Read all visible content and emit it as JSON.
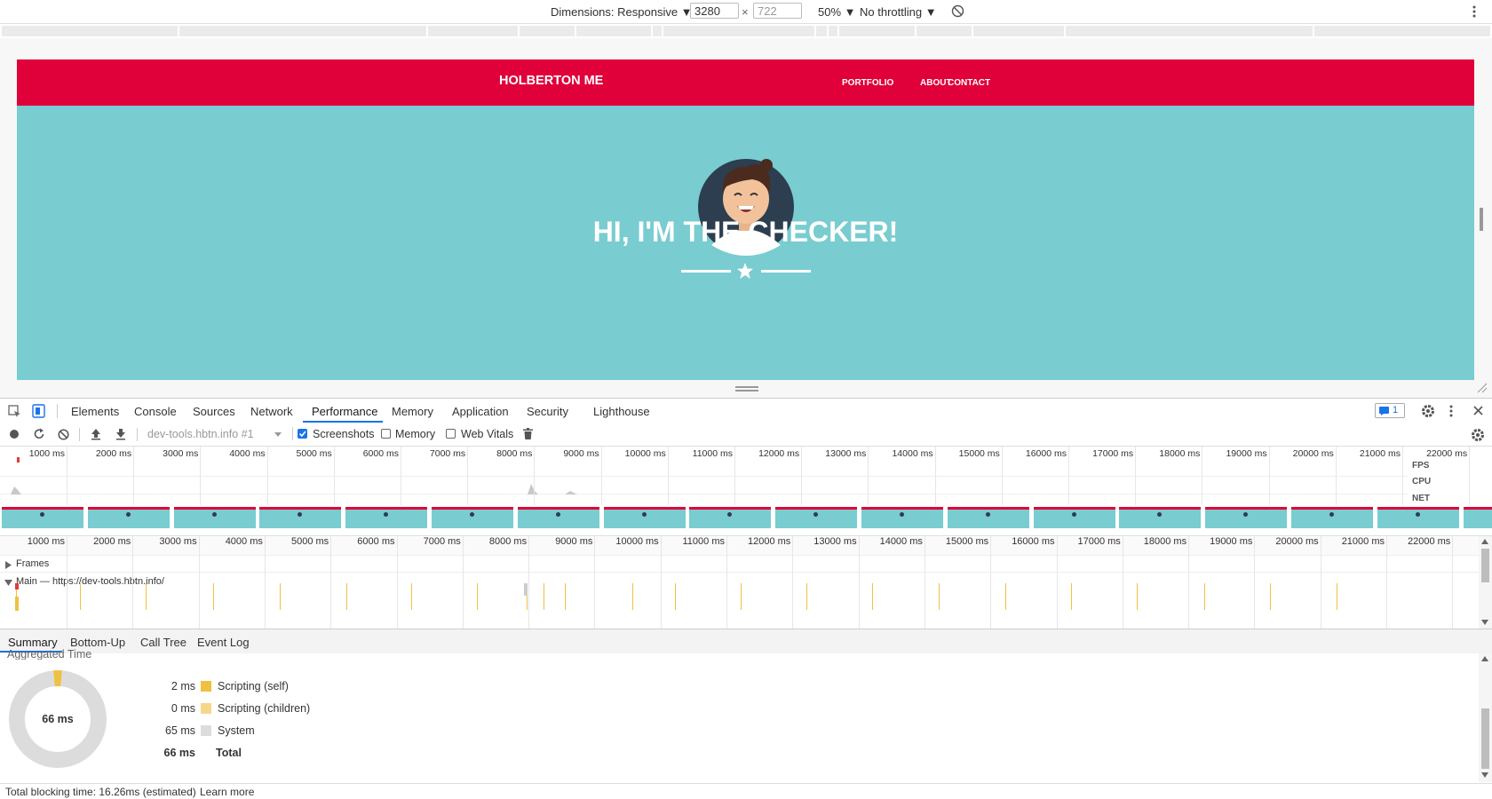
{
  "device_toolbar": {
    "dimensions_label": "Dimensions: Responsive ▼",
    "width": "3280",
    "height_placeholder": "722",
    "times": "×",
    "zoom": "50% ▼",
    "throttling": "No throttling ▼"
  },
  "site": {
    "brand": "HOLBERTON ME",
    "nav": [
      "PORTFOLIO",
      "ABOUT",
      "CONTACT"
    ],
    "heading": "HI, I'M THE CHECKER!"
  },
  "devtools_tabs": [
    "Elements",
    "Console",
    "Sources",
    "Network",
    "Performance",
    "Memory",
    "Application",
    "Security",
    "Lighthouse"
  ],
  "active_tab": "Performance",
  "issues_count": "1",
  "perf_toolbar": {
    "recording_select": "dev-tools.hbtn.info #1",
    "screenshots_label": "Screenshots",
    "memory_label": "Memory",
    "web_vitals_label": "Web Vitals"
  },
  "overview": {
    "ticks": [
      "1000 ms",
      "2000 ms",
      "3000 ms",
      "4000 ms",
      "5000 ms",
      "6000 ms",
      "7000 ms",
      "8000 ms",
      "9000 ms",
      "10000 ms",
      "11000 ms",
      "12000 ms",
      "13000 ms",
      "14000 ms",
      "15000 ms",
      "16000 ms",
      "17000 ms",
      "18000 ms",
      "19000 ms",
      "20000 ms",
      "21000 ms",
      "22000 ms"
    ],
    "labels": [
      "FPS",
      "CPU",
      "NET"
    ]
  },
  "flame": {
    "ticks": [
      "1000 ms",
      "2000 ms",
      "3000 ms",
      "4000 ms",
      "5000 ms",
      "6000 ms",
      "7000 ms",
      "8000 ms",
      "9000 ms",
      "10000 ms",
      "11000 ms",
      "12000 ms",
      "13000 ms",
      "14000 ms",
      "15000 ms",
      "16000 ms",
      "17000 ms",
      "18000 ms",
      "19000 ms",
      "20000 ms",
      "21000 ms",
      "22000 ms"
    ],
    "frames_label": "Frames",
    "main_label": "Main — https://dev-tools.hbtn.info/"
  },
  "bottom_tabs": [
    "Summary",
    "Bottom-Up",
    "Call Tree",
    "Event Log"
  ],
  "summary": {
    "section_title": "Aggregated Time",
    "total_center": "66 ms",
    "rows": [
      {
        "value": "2 ms",
        "label": "Scripting (self)",
        "color": "#f0c040"
      },
      {
        "value": "0 ms",
        "label": "Scripting (children)",
        "color": "#f5d78a"
      },
      {
        "value": "65 ms",
        "label": "System",
        "color": "#dcdcdc"
      },
      {
        "value": "66 ms",
        "label": "Total",
        "color": ""
      }
    ]
  },
  "status": {
    "text": "Total blocking time: 16.26ms (estimated)",
    "link": "Learn more"
  },
  "colors": {
    "brand_red": "#e0003a",
    "hero_teal": "#79ccd0",
    "devtools_blue": "#1a73e8"
  }
}
